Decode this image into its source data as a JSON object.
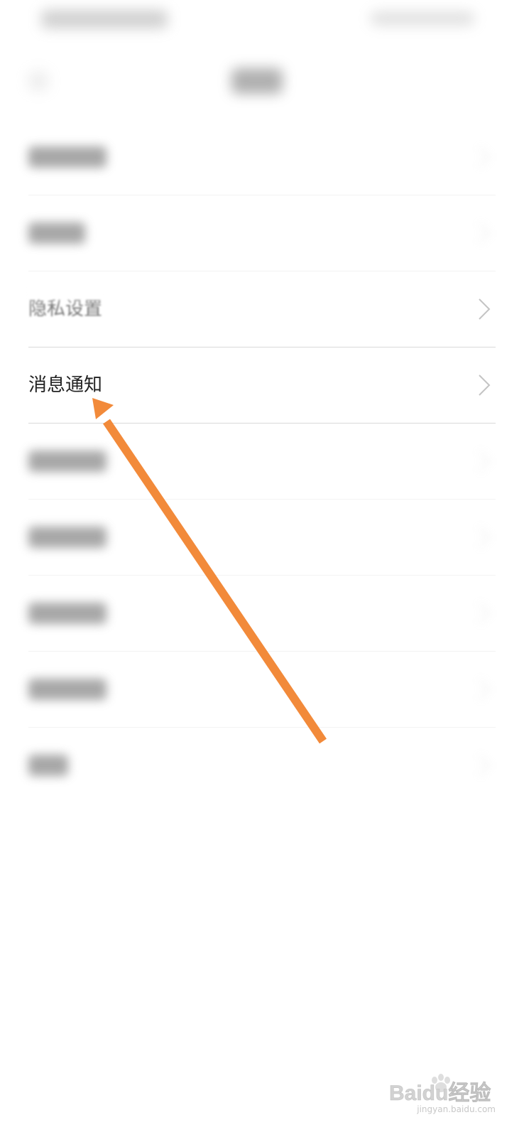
{
  "settings": {
    "items": [
      {
        "label": "",
        "state": "blurred"
      },
      {
        "label": "",
        "state": "blurred"
      },
      {
        "label": "隐私设置",
        "state": "partial"
      },
      {
        "label": "消息通知",
        "state": "sharp"
      },
      {
        "label": "",
        "state": "blurred"
      },
      {
        "label": "",
        "state": "blurred"
      },
      {
        "label": "",
        "state": "blurred"
      },
      {
        "label": "",
        "state": "blurred"
      },
      {
        "label": "",
        "state": "blurred"
      }
    ]
  },
  "annotation": {
    "color": "#f28a3a",
    "target": "消息通知"
  },
  "watermark": {
    "brand": "Baidu经验",
    "url": "jingyan.baidu.com"
  },
  "colors": {
    "background": "#ffffff",
    "text": "#222222",
    "divider": "#d9d9d9",
    "chevron": "#c4c4c4",
    "arrow": "#f28a3a"
  },
  "icons": {
    "row_chevron": "chevron-right-icon",
    "back": "back-arrow-icon",
    "arrow": "annotation-arrow-icon"
  }
}
